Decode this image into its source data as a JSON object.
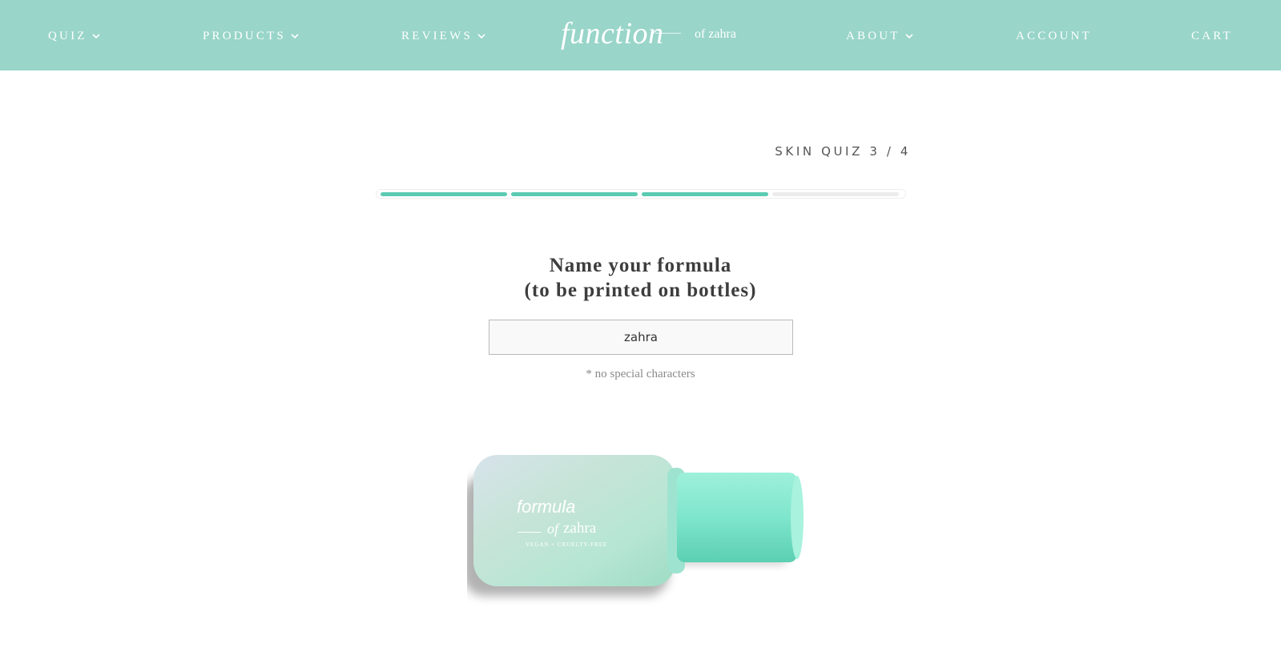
{
  "header": {
    "nav_left": [
      {
        "label": "QUIZ",
        "has_dropdown": true
      },
      {
        "label": "PRODUCTS",
        "has_dropdown": true
      },
      {
        "label": "REVIEWS",
        "has_dropdown": true
      }
    ],
    "logo": {
      "main": "function",
      "sub": "of zahra"
    },
    "nav_right": [
      {
        "label": "ABOUT",
        "has_dropdown": true
      },
      {
        "label": "ACCOUNT",
        "has_dropdown": false
      },
      {
        "label": "CART",
        "has_dropdown": false
      }
    ]
  },
  "quiz": {
    "step_label": "SKIN QUIZ 3 / 4",
    "progress": {
      "completed": 3,
      "total": 4
    },
    "question_line1": "Name your formula",
    "question_line2": "(to be printed on bottles)",
    "input_value": "zahra",
    "hint": "* no special characters"
  },
  "bottle_label": {
    "formula": "formula",
    "of": "of",
    "name": "zahra",
    "tagline": "VEGAN + CRUELTY-FREE"
  },
  "colors": {
    "header_bg": "#99d5c9",
    "progress_done": "#5ccbb2",
    "progress_todo": "#ececec",
    "bottle_cap": "#7ee6cc"
  }
}
